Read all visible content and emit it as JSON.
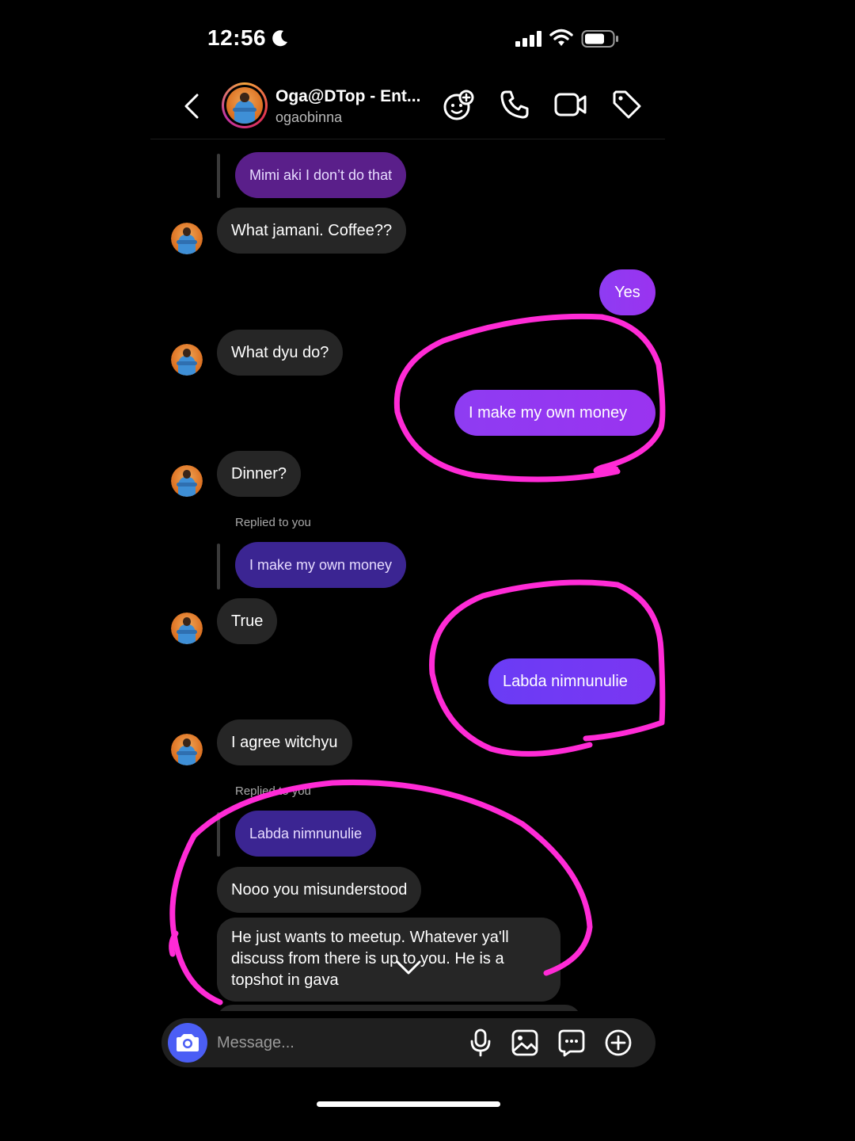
{
  "status_bar": {
    "time": "12:56"
  },
  "header": {
    "contact_name": "Oga@DTop - Ent...",
    "contact_username": "ogaobinna",
    "icons": [
      "back-icon",
      "add-emoji-icon",
      "phone-icon",
      "video-icon",
      "tag-icon"
    ]
  },
  "messages": {
    "quote1": "Mimi aki I don’t do that",
    "m1": "What jamani. Coffee??",
    "m2": "Yes",
    "m3": "What dyu do?",
    "m4": "I make my own money",
    "m5": "Dinner?",
    "replied1": "Replied to you",
    "quote2": "I make my own money",
    "m6": "True",
    "m7": "Labda nimnunulie",
    "m8": "I agree witchyu",
    "replied2": "Replied to you",
    "quote3": "Labda nimnunulie",
    "m9": "Nooo you misunderstood",
    "m10": "He just wants to meetup. Whatever ya'll discuss from there is up to you.  He is a topshot in gava"
  },
  "composer": {
    "placeholder": "Message...",
    "icons": [
      "camera-icon",
      "microphone-icon",
      "gallery-icon",
      "sticker-icon",
      "plus-icon"
    ]
  },
  "colors": {
    "background": "#000000",
    "incoming_bubble": "#262626",
    "outgoing_bubble": "#9a33f0",
    "annotation_scribble": "#ff2bd6"
  }
}
